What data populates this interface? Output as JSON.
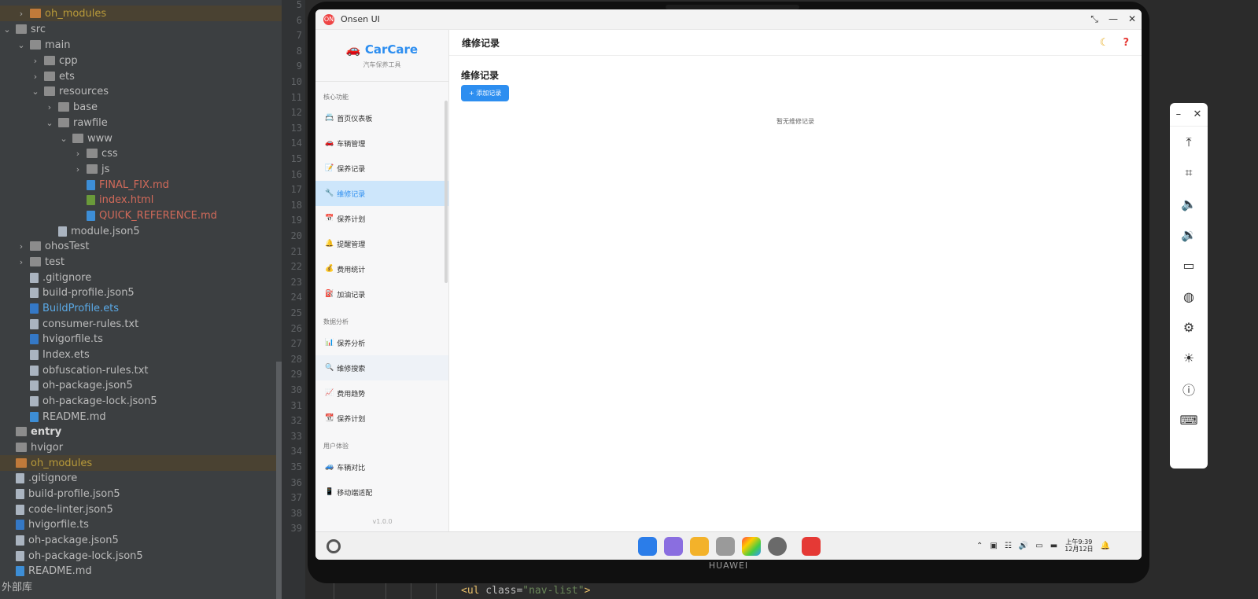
{
  "tree": [
    {
      "label": "oh_modules",
      "indent": 1,
      "arrow": "›",
      "icon": "folder",
      "hl": true,
      "cls": "txt-yellow"
    },
    {
      "label": "src",
      "indent": 0,
      "arrow": "⌄",
      "icon": "folder"
    },
    {
      "label": "main",
      "indent": 1,
      "arrow": "⌄",
      "icon": "folder"
    },
    {
      "label": "cpp",
      "indent": 2,
      "arrow": "›",
      "icon": "folder"
    },
    {
      "label": "ets",
      "indent": 2,
      "arrow": "›",
      "icon": "folder"
    },
    {
      "label": "resources",
      "indent": 2,
      "arrow": "⌄",
      "icon": "folder"
    },
    {
      "label": "base",
      "indent": 3,
      "arrow": "›",
      "icon": "folder"
    },
    {
      "label": "rawfile",
      "indent": 3,
      "arrow": "⌄",
      "icon": "folder"
    },
    {
      "label": "www",
      "indent": 4,
      "arrow": "⌄",
      "icon": "folder"
    },
    {
      "label": "css",
      "indent": 5,
      "arrow": "›",
      "icon": "folder"
    },
    {
      "label": "js",
      "indent": 5,
      "arrow": "›",
      "icon": "folder"
    },
    {
      "label": "FINAL_FIX.md",
      "indent": 5,
      "arrow": "",
      "icon": "md",
      "cls": "txt-red"
    },
    {
      "label": "index.html",
      "indent": 5,
      "arrow": "",
      "icon": "html",
      "cls": "txt-red"
    },
    {
      "label": "QUICK_REFERENCE.md",
      "indent": 5,
      "arrow": "",
      "icon": "md",
      "cls": "txt-red"
    },
    {
      "label": "module.json5",
      "indent": 3,
      "arrow": "",
      "icon": "file"
    },
    {
      "label": "ohosTest",
      "indent": 1,
      "arrow": "›",
      "icon": "folder"
    },
    {
      "label": "test",
      "indent": 1,
      "arrow": "›",
      "icon": "folder"
    },
    {
      "label": ".gitignore",
      "indent": 1,
      "arrow": "",
      "icon": "file"
    },
    {
      "label": "build-profile.json5",
      "indent": 1,
      "arrow": "",
      "icon": "file"
    },
    {
      "label": "BuildProfile.ets",
      "indent": 1,
      "arrow": "",
      "icon": "ts",
      "cls": "txt-blue"
    },
    {
      "label": "consumer-rules.txt",
      "indent": 1,
      "arrow": "",
      "icon": "file"
    },
    {
      "label": "hvigorfile.ts",
      "indent": 1,
      "arrow": "",
      "icon": "ts"
    },
    {
      "label": "Index.ets",
      "indent": 1,
      "arrow": "",
      "icon": "file"
    },
    {
      "label": "obfuscation-rules.txt",
      "indent": 1,
      "arrow": "",
      "icon": "file"
    },
    {
      "label": "oh-package.json5",
      "indent": 1,
      "arrow": "",
      "icon": "file"
    },
    {
      "label": "oh-package-lock.json5",
      "indent": 1,
      "arrow": "",
      "icon": "file"
    },
    {
      "label": "README.md",
      "indent": 1,
      "arrow": "",
      "icon": "md"
    },
    {
      "label": "entry",
      "indent": 0,
      "arrow": "",
      "icon": "folder",
      "cls": "txt-bold"
    },
    {
      "label": "hvigor",
      "indent": 0,
      "arrow": "",
      "icon": "folder"
    },
    {
      "label": "oh_modules",
      "indent": 0,
      "arrow": "",
      "icon": "folder",
      "hl": true,
      "cls": "txt-yellow"
    },
    {
      "label": ".gitignore",
      "indent": 0,
      "arrow": "",
      "icon": "file"
    },
    {
      "label": "build-profile.json5",
      "indent": 0,
      "arrow": "",
      "icon": "file"
    },
    {
      "label": "code-linter.json5",
      "indent": 0,
      "arrow": "",
      "icon": "file"
    },
    {
      "label": "hvigorfile.ts",
      "indent": 0,
      "arrow": "",
      "icon": "ts"
    },
    {
      "label": "oh-package.json5",
      "indent": 0,
      "arrow": "",
      "icon": "file"
    },
    {
      "label": "oh-package-lock.json5",
      "indent": 0,
      "arrow": "",
      "icon": "file"
    },
    {
      "label": "README.md",
      "indent": 0,
      "arrow": "",
      "icon": "md"
    },
    {
      "label": "外部库",
      "indent": -1,
      "arrow": "",
      "icon": ""
    }
  ],
  "line_numbers": [
    "5",
    "6",
    "7",
    "8",
    "9",
    "10",
    "11",
    "12",
    "13",
    "14",
    "15",
    "16",
    "17",
    "18",
    "19",
    "20",
    "21",
    "22",
    "23",
    "24",
    "25",
    "26",
    "27",
    "28",
    "29",
    "30",
    "31",
    "32",
    "33",
    "34",
    "35",
    "36",
    "37",
    "38",
    "39"
  ],
  "code_line": {
    "tag": "<ul",
    "attr": " class=",
    "val": "\"nav-list\"",
    "end": ">"
  },
  "device": {
    "brand": "HUAWEI"
  },
  "window": {
    "title": "Onsen UI",
    "logo": "ON"
  },
  "app": {
    "brand_title": "🚗 CarCare",
    "brand_sub": "汽车保养工具",
    "version": "v1.0.0",
    "sections": [
      {
        "title": "核心功能",
        "items": [
          {
            "icon": "📇",
            "label": "首页仪表板"
          },
          {
            "icon": "🚗",
            "label": "车辆管理"
          },
          {
            "icon": "📝",
            "label": "保养记录"
          },
          {
            "icon": "🔧",
            "label": "维修记录",
            "active": true
          },
          {
            "icon": "📅",
            "label": "保养计划"
          },
          {
            "icon": "🔔",
            "label": "提醒管理"
          },
          {
            "icon": "💰",
            "label": "费用统计"
          },
          {
            "icon": "⛽",
            "label": "加油记录"
          }
        ]
      },
      {
        "title": "数据分析",
        "items": [
          {
            "icon": "📊",
            "label": "保养分析"
          },
          {
            "icon": "🔍",
            "label": "维修搜索",
            "hover": true
          },
          {
            "icon": "📈",
            "label": "费用趋势"
          },
          {
            "icon": "📆",
            "label": "保养计划"
          }
        ]
      },
      {
        "title": "用户体验",
        "items": [
          {
            "icon": "🚙",
            "label": "车辆对比"
          },
          {
            "icon": "📱",
            "label": "移动端适配"
          }
        ]
      }
    ],
    "header_title": "维修记录",
    "content_title": "维修记录",
    "add_button": "+ 添加记录",
    "empty_text": "暂无维修记录"
  },
  "taskbar": {
    "time": "上午9:39",
    "date": "12月12日"
  },
  "colors": {
    "accent": "#2d8ef0",
    "active_bg": "#cde6fb"
  }
}
